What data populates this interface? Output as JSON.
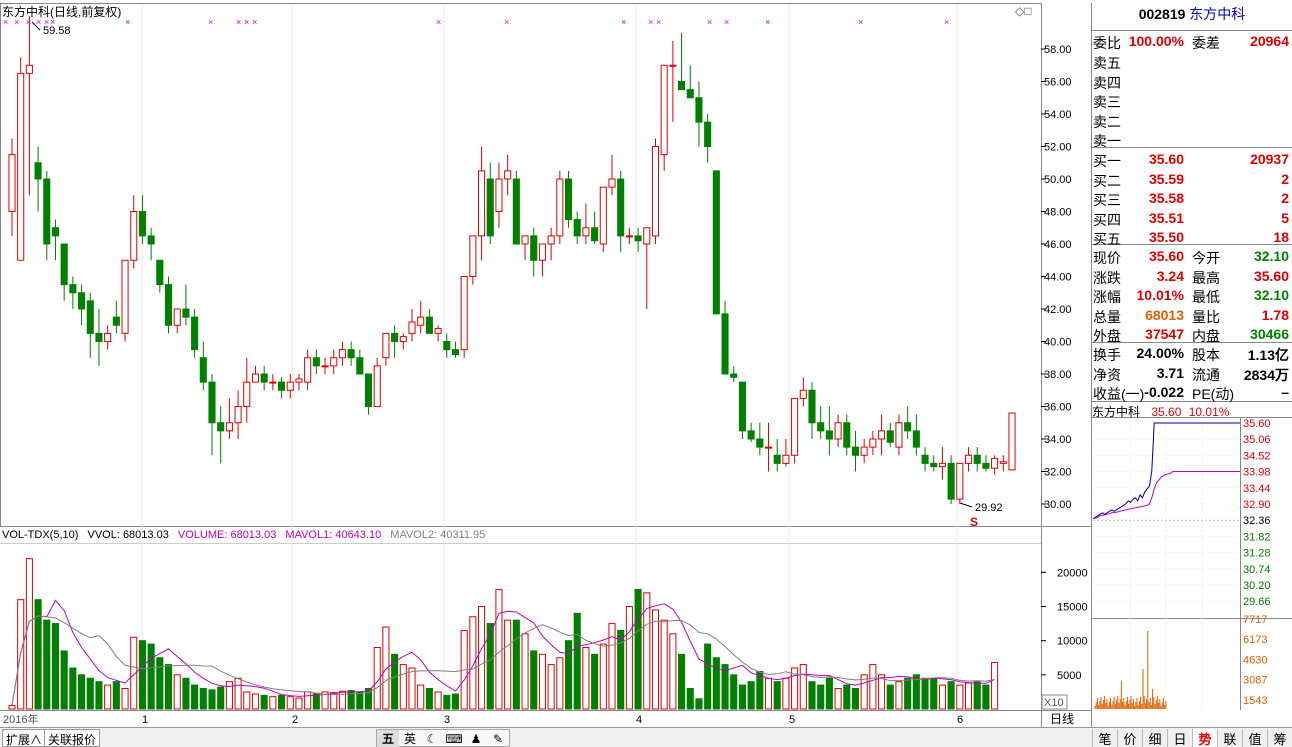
{
  "chart_title": "东方中科(日线,前复权)",
  "vol_header": {
    "name": "VOL-TDX(5,10)",
    "vvol": "VVOL: 68013.03",
    "volume": "VOLUME: 68013.03",
    "mavol1": "MAVOL1: 40643.10",
    "mavol2": "MAVOL2: 40311.95"
  },
  "annotations": {
    "high_label": "59.58",
    "low_label": "29.92",
    "s_marker": "S",
    "x10": "X10",
    "period": "日线",
    "diamonds": "◇□"
  },
  "price_axis": [
    "58.00",
    "56.00",
    "54.00",
    "52.00",
    "50.00",
    "48.00",
    "46.00",
    "44.00",
    "42.00",
    "40.00",
    "38.00",
    "36.00",
    "34.00",
    "32.00",
    "30.00"
  ],
  "vol_axis": [
    "20000",
    "15000",
    "10000",
    "5000"
  ],
  "x_labels": [
    "2016年",
    "1",
    "2",
    "3",
    "4",
    "5",
    "6"
  ],
  "quote": {
    "code": "002819",
    "name": "东方中科",
    "weibi_label": "委比",
    "weibi": "100.00%",
    "weicha_label": "委差",
    "weicha": "20964",
    "sells": [
      {
        "label": "卖五",
        "price": "",
        "vol": ""
      },
      {
        "label": "卖四",
        "price": "",
        "vol": ""
      },
      {
        "label": "卖三",
        "price": "",
        "vol": ""
      },
      {
        "label": "卖二",
        "price": "",
        "vol": ""
      },
      {
        "label": "卖一",
        "price": "",
        "vol": ""
      }
    ],
    "buys": [
      {
        "label": "买一",
        "price": "35.60",
        "vol": "20937"
      },
      {
        "label": "买二",
        "price": "35.59",
        "vol": "2"
      },
      {
        "label": "买三",
        "price": "35.58",
        "vol": "2"
      },
      {
        "label": "买四",
        "price": "35.51",
        "vol": "5"
      },
      {
        "label": "买五",
        "price": "35.50",
        "vol": "18"
      }
    ],
    "stats": [
      {
        "l1": "现价",
        "v1": "35.60",
        "c1": "red",
        "l2": "今开",
        "v2": "32.10",
        "c2": "green"
      },
      {
        "l1": "涨跌",
        "v1": "3.24",
        "c1": "red",
        "l2": "最高",
        "v2": "35.60",
        "c2": "red"
      },
      {
        "l1": "涨幅",
        "v1": "10.01%",
        "c1": "red",
        "l2": "最低",
        "v2": "32.10",
        "c2": "green"
      },
      {
        "l1": "总量",
        "v1": "68013",
        "c1": "orange",
        "l2": "量比",
        "v2": "1.78",
        "c2": "red"
      },
      {
        "l1": "外盘",
        "v1": "37547",
        "c1": "red",
        "l2": "内盘",
        "v2": "30466",
        "c2": "green"
      }
    ],
    "fund": [
      {
        "l1": "换手",
        "v1": "24.00%",
        "l2": "股本",
        "v2": "1.13亿"
      },
      {
        "l1": "净资",
        "v1": "3.71",
        "l2": "流通",
        "v2": "2834万"
      },
      {
        "l1": "收益(一)",
        "v1": "-0.022",
        "l2": "PE(动)",
        "v2": "–"
      }
    ]
  },
  "mini": {
    "name": "东方中科",
    "price": "35.60",
    "pct": "10.01%",
    "price_axis": [
      "35.60",
      "35.06",
      "34.52",
      "33.98",
      "33.44",
      "32.90",
      "32.36",
      "31.82",
      "31.28",
      "30.74",
      "30.20",
      "29.66"
    ],
    "vol_axis": [
      "7717",
      "6173",
      "4630",
      "3087",
      "1543"
    ]
  },
  "bottom": {
    "tab1": "扩展",
    "tab2": "关联报价",
    "ime": [
      "五",
      "英",
      "☾",
      "⌨",
      "♟",
      "✎"
    ],
    "right_tabs": [
      "笔",
      "价",
      "细",
      "日",
      "势",
      "联",
      "值",
      "筹"
    ],
    "active_tab": "势"
  },
  "chart_data": {
    "type": "candlestick",
    "title": "东方中科(日线,前复权)",
    "ylim": [
      29,
      59.5
    ],
    "candles": [
      [
        48,
        52.5,
        46.5,
        51.5
      ],
      [
        45,
        57.5,
        45,
        56.5
      ],
      [
        56.5,
        60,
        49,
        57
      ],
      [
        51,
        52,
        48,
        50
      ],
      [
        50,
        50.5,
        45,
        46
      ],
      [
        47,
        47.5,
        45,
        46.5
      ],
      [
        46,
        46,
        42.5,
        43.5
      ],
      [
        43.5,
        44,
        42,
        43
      ],
      [
        43,
        43.5,
        41,
        42
      ],
      [
        42.5,
        43,
        39,
        40.5
      ],
      [
        40.5,
        42,
        38.5,
        40
      ],
      [
        40,
        41,
        39.5,
        40.5
      ],
      [
        41.5,
        42.5,
        40.5,
        41
      ],
      [
        40.5,
        45,
        40,
        45
      ],
      [
        45,
        49,
        44.5,
        48
      ],
      [
        48,
        49,
        46,
        46.5
      ],
      [
        46.5,
        47,
        45,
        46
      ],
      [
        45,
        45,
        43,
        43.5
      ],
      [
        43.5,
        44,
        40.5,
        41
      ],
      [
        41,
        42,
        40.5,
        42
      ],
      [
        42,
        43.5,
        41,
        41.5
      ],
      [
        41.5,
        42,
        39,
        39.5
      ],
      [
        39,
        40,
        37,
        37.5
      ],
      [
        37.5,
        38,
        33,
        35
      ],
      [
        35,
        36,
        32.5,
        34.5
      ],
      [
        34.5,
        36.5,
        34,
        35
      ],
      [
        35,
        37,
        34,
        36
      ],
      [
        36,
        39,
        35,
        37.5
      ],
      [
        37.5,
        38.5,
        37.5,
        38
      ],
      [
        38,
        38.5,
        37,
        37.5
      ],
      [
        37.5,
        38,
        37,
        37.5
      ],
      [
        37.5,
        37.8,
        36.5,
        37
      ],
      [
        37,
        38,
        36.5,
        37.5
      ],
      [
        37.5,
        38,
        37,
        37.7
      ],
      [
        37.5,
        39.5,
        37,
        39
      ],
      [
        39,
        39.5,
        38,
        38.5
      ],
      [
        38.5,
        39,
        38,
        38.5
      ],
      [
        38.5,
        39.5,
        38,
        39
      ],
      [
        39,
        40,
        38.5,
        39.5
      ],
      [
        39.5,
        40,
        38.5,
        39
      ],
      [
        39,
        39.5,
        38,
        38
      ],
      [
        38,
        38,
        35.5,
        36
      ],
      [
        36,
        39,
        36,
        38.5
      ],
      [
        39,
        40.5,
        38.5,
        40.5
      ],
      [
        40.5,
        41,
        39,
        40
      ],
      [
        40,
        40.5,
        39.5,
        40.3
      ],
      [
        40.5,
        42,
        40,
        41.2
      ],
      [
        41,
        42.5,
        40.5,
        41.5
      ],
      [
        41.5,
        42,
        40.5,
        40.5
      ],
      [
        40.5,
        41,
        40,
        40.8
      ],
      [
        40,
        40.5,
        39,
        39.5
      ],
      [
        39.5,
        40,
        39,
        39.2
      ],
      [
        39.5,
        44,
        39,
        44
      ],
      [
        44,
        46.5,
        43.5,
        46.5
      ],
      [
        46.5,
        52,
        45,
        50.5
      ],
      [
        50,
        51,
        46,
        46.5
      ],
      [
        48,
        51,
        47,
        50
      ],
      [
        50,
        51.5,
        49,
        50.5
      ],
      [
        50,
        50.5,
        46,
        46
      ],
      [
        46,
        46.5,
        45,
        46.5
      ],
      [
        46.5,
        47,
        44,
        45
      ],
      [
        45,
        46,
        44,
        46
      ],
      [
        46,
        47,
        45,
        46.5
      ],
      [
        46.5,
        50.5,
        46,
        50
      ],
      [
        50,
        50.5,
        47,
        47.5
      ],
      [
        47.5,
        48,
        46,
        46.5
      ],
      [
        46.5,
        48.5,
        46,
        47
      ],
      [
        47,
        48,
        46,
        46.2
      ],
      [
        46,
        49.5,
        45.5,
        49.5
      ],
      [
        49.5,
        51.5,
        49,
        50
      ],
      [
        50,
        50.5,
        45.5,
        46.5
      ],
      [
        46.5,
        47,
        46,
        46.5
      ],
      [
        46.5,
        47,
        45.5,
        46.2
      ],
      [
        46,
        47,
        42,
        47
      ],
      [
        46.5,
        52.5,
        46,
        52
      ],
      [
        51.5,
        57,
        50.5,
        57
      ],
      [
        57,
        58.5,
        53.5,
        57
      ],
      [
        56,
        59,
        55.5,
        55.5
      ],
      [
        55.5,
        57,
        55,
        55
      ],
      [
        55,
        56,
        52,
        53.5
      ],
      [
        53.5,
        54,
        51,
        52
      ],
      [
        50.5,
        46,
        42,
        41.7
      ],
      [
        41.7,
        42.5,
        38,
        38
      ],
      [
        38,
        38.5,
        37.5,
        37.8
      ],
      [
        37.5,
        37.5,
        34,
        34.5
      ],
      [
        34.5,
        35,
        33.8,
        34
      ],
      [
        34,
        35,
        33,
        33.5
      ],
      [
        33.5,
        35,
        32,
        33.5
      ],
      [
        33,
        34,
        32,
        32.5
      ],
      [
        32.5,
        34,
        32.3,
        33
      ],
      [
        33,
        36.5,
        32.5,
        36.5
      ],
      [
        36.5,
        37.8,
        36,
        37
      ],
      [
        37,
        37.5,
        34,
        35
      ],
      [
        35,
        36,
        34,
        34.5
      ],
      [
        34.5,
        36,
        33,
        34
      ],
      [
        34,
        35.5,
        33.5,
        35
      ],
      [
        35,
        35.5,
        33,
        33.5
      ],
      [
        33.5,
        34.5,
        32,
        33
      ],
      [
        33,
        34,
        32.5,
        33.5
      ],
      [
        33.5,
        34.5,
        33,
        34
      ],
      [
        34,
        35.5,
        33,
        34.5
      ],
      [
        34.5,
        35,
        33.5,
        33.8
      ],
      [
        33.5,
        35.5,
        33,
        35
      ],
      [
        35,
        36,
        34,
        34.5
      ],
      [
        34.5,
        35.5,
        33,
        33.5
      ],
      [
        33,
        33.5,
        32,
        32.5
      ],
      [
        32.5,
        33,
        32,
        32.3
      ],
      [
        32.3,
        33.5,
        31.5,
        32.5
      ],
      [
        32.5,
        33,
        30,
        30.3
      ],
      [
        30.3,
        32.5,
        30,
        32.5
      ],
      [
        32.5,
        33.5,
        32,
        33
      ],
      [
        33,
        33.5,
        32,
        32.5
      ],
      [
        32.5,
        33,
        32,
        32.2
      ],
      [
        32.2,
        33,
        31.8,
        32.8
      ],
      [
        32.5,
        33,
        32,
        32.6
      ],
      [
        32.1,
        35.6,
        32.1,
        35.6
      ]
    ],
    "volume": [
      500,
      16000,
      22000,
      16000,
      13000,
      12500,
      8500,
      6000,
      5000,
      4500,
      4000,
      3500,
      4000,
      3000,
      10500,
      10000,
      9500,
      7500,
      6500,
      5000,
      4500,
      3500,
      3000,
      2800,
      3200,
      4000,
      4500,
      2500,
      2200,
      2000,
      1800,
      2000,
      1800,
      1600,
      2500,
      2300,
      2500,
      2400,
      2600,
      2700,
      2500,
      3000,
      9000,
      12000,
      8000,
      6500,
      6000,
      3500,
      3000,
      2500,
      2000,
      2200,
      11500,
      13500,
      15000,
      12500,
      17500,
      13000,
      13000,
      11000,
      8500,
      8000,
      6500,
      7500,
      10000,
      14000,
      9000,
      8000,
      9500,
      12500,
      11500,
      15000,
      17500,
      17000,
      14500,
      13000,
      11000,
      8000,
      3000,
      1500,
      9500,
      7500,
      6500,
      5000,
      3500,
      4000,
      5500,
      4500,
      4000,
      4500,
      6000,
      6500,
      4000,
      3500,
      4500,
      3000,
      3500,
      3000,
      5000,
      6500,
      5000,
      3500,
      4000,
      4500,
      5000,
      4500,
      4500,
      3500,
      4000,
      3500,
      3800,
      4000,
      3500,
      6800
    ],
    "volume_axis_max": 24000,
    "mini_line": [
      32.4,
      32.45,
      32.5,
      32.55,
      32.6,
      32.55,
      32.6,
      32.65,
      32.7,
      32.65,
      32.7,
      32.75,
      32.8,
      32.85,
      32.9,
      33.0,
      32.95,
      33.05,
      33.1,
      33.0,
      33.2,
      33.1,
      33.3,
      33.4,
      33.5,
      34.0,
      35.6,
      35.6,
      35.6,
      35.6,
      35.6,
      35.6,
      35.6,
      35.6,
      35.6
    ],
    "mini_avg": [
      32.4,
      32.42,
      32.45,
      32.5,
      32.52,
      32.53,
      32.55,
      32.57,
      32.6,
      32.61,
      32.62,
      32.64,
      32.66,
      32.68,
      32.7,
      32.72,
      32.73,
      32.75,
      32.77,
      32.78,
      32.8,
      32.81,
      32.83,
      32.85,
      32.9,
      33.1,
      33.4,
      33.6,
      33.7,
      33.8,
      33.85,
      33.88,
      33.9,
      33.92,
      33.98
    ]
  }
}
